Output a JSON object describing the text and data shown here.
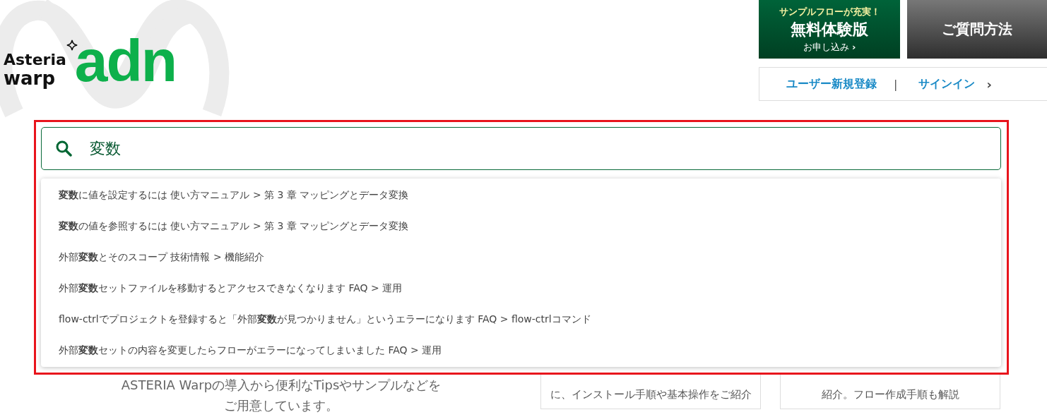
{
  "logo": {
    "brand_top": "Asteria",
    "brand_bottom": "warp",
    "wordmark": "adn"
  },
  "trial_button": {
    "tagline": "サンプルフローが充実！",
    "title": "無料体験版",
    "action": "お申し込み",
    "chevron": "›"
  },
  "question_button": {
    "label": "ご質問方法"
  },
  "account_links": {
    "register": "ユーザー新規登録",
    "separator": "|",
    "signin": "サインイン",
    "chevron": "›"
  },
  "search": {
    "value": "変数"
  },
  "suggestions": [
    {
      "text": "**変数**に値を設定するには 使い方マニュアル > 第 3 章 マッピングとデータ変換"
    },
    {
      "text": "**変数**の値を参照するには 使い方マニュアル > 第 3 章 マッピングとデータ変換"
    },
    {
      "text": "外部**変数**とそのスコープ 技術情報 > 機能紹介"
    },
    {
      "text": "外部**変数**セットファイルを移動するとアクセスできなくなります FAQ > 運用"
    },
    {
      "text": "flow-ctrlでプロジェクトを登録すると「外部**変数**が見つかりません」というエラーになります FAQ > flow-ctrlコマンド"
    },
    {
      "text": "外部**変数**セットの内容を変更したらフローがエラーになってしまいました FAQ > 運用"
    }
  ],
  "intro": [
    "ASTERIA Warpの導入から便利なTipsやサンプルなどを",
    "ご用意しています。"
  ],
  "cards": [
    {
      "text": "に、インストール手順や基本操作をご紹介"
    },
    {
      "text": "紹介。フロー作成手順も解説"
    }
  ]
}
